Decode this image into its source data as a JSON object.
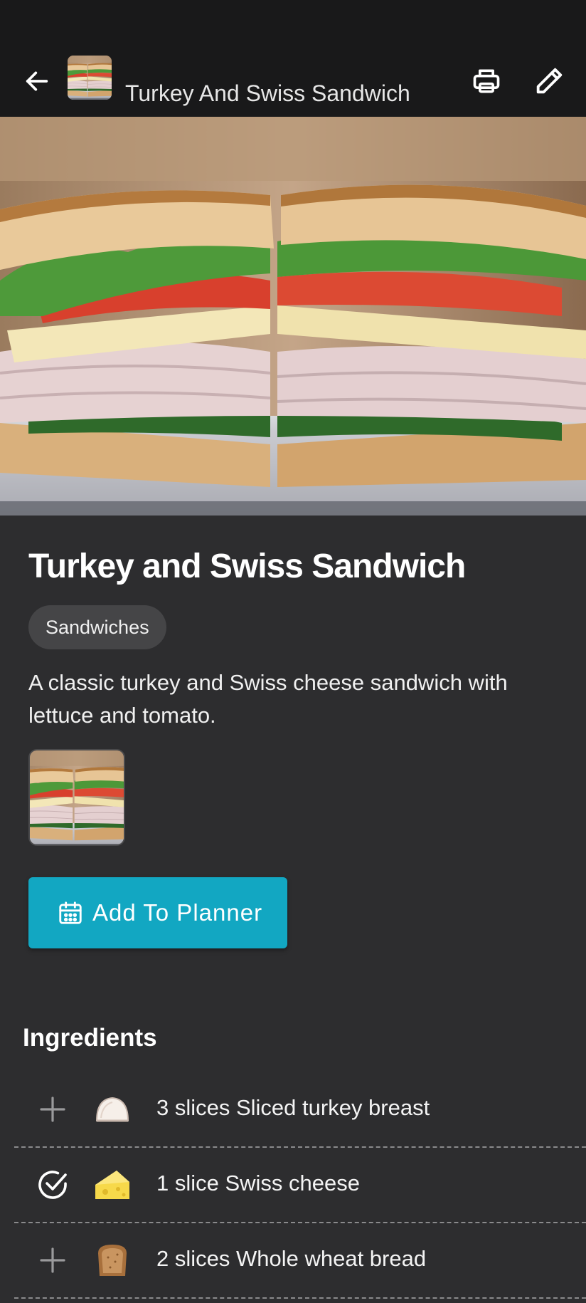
{
  "header": {
    "title": "Turkey And Swiss Sandwich",
    "back_icon": "arrow-left-icon",
    "print_icon": "printer-icon",
    "edit_icon": "pencil-icon"
  },
  "recipe": {
    "name": "Turkey and Swiss Sandwich",
    "category": "Sandwiches",
    "description": "A classic turkey and Swiss cheese sandwich with lettuce and tomato."
  },
  "planner_button": {
    "label": "Add To Planner",
    "icon": "calendar-icon"
  },
  "ingredients": {
    "heading": "Ingredients",
    "items": [
      {
        "text": "3 slices Sliced turkey breast",
        "checked": false,
        "icon": "turkey-slice-icon"
      },
      {
        "text": "1 slice Swiss cheese",
        "checked": true,
        "icon": "cheese-icon"
      },
      {
        "text": "2 slices Whole wheat bread",
        "checked": false,
        "icon": "bread-icon"
      }
    ]
  },
  "colors": {
    "app_bar": "#19191a",
    "background": "#2d2d2f",
    "accent": "#12a7c2",
    "chip": "#454547"
  }
}
